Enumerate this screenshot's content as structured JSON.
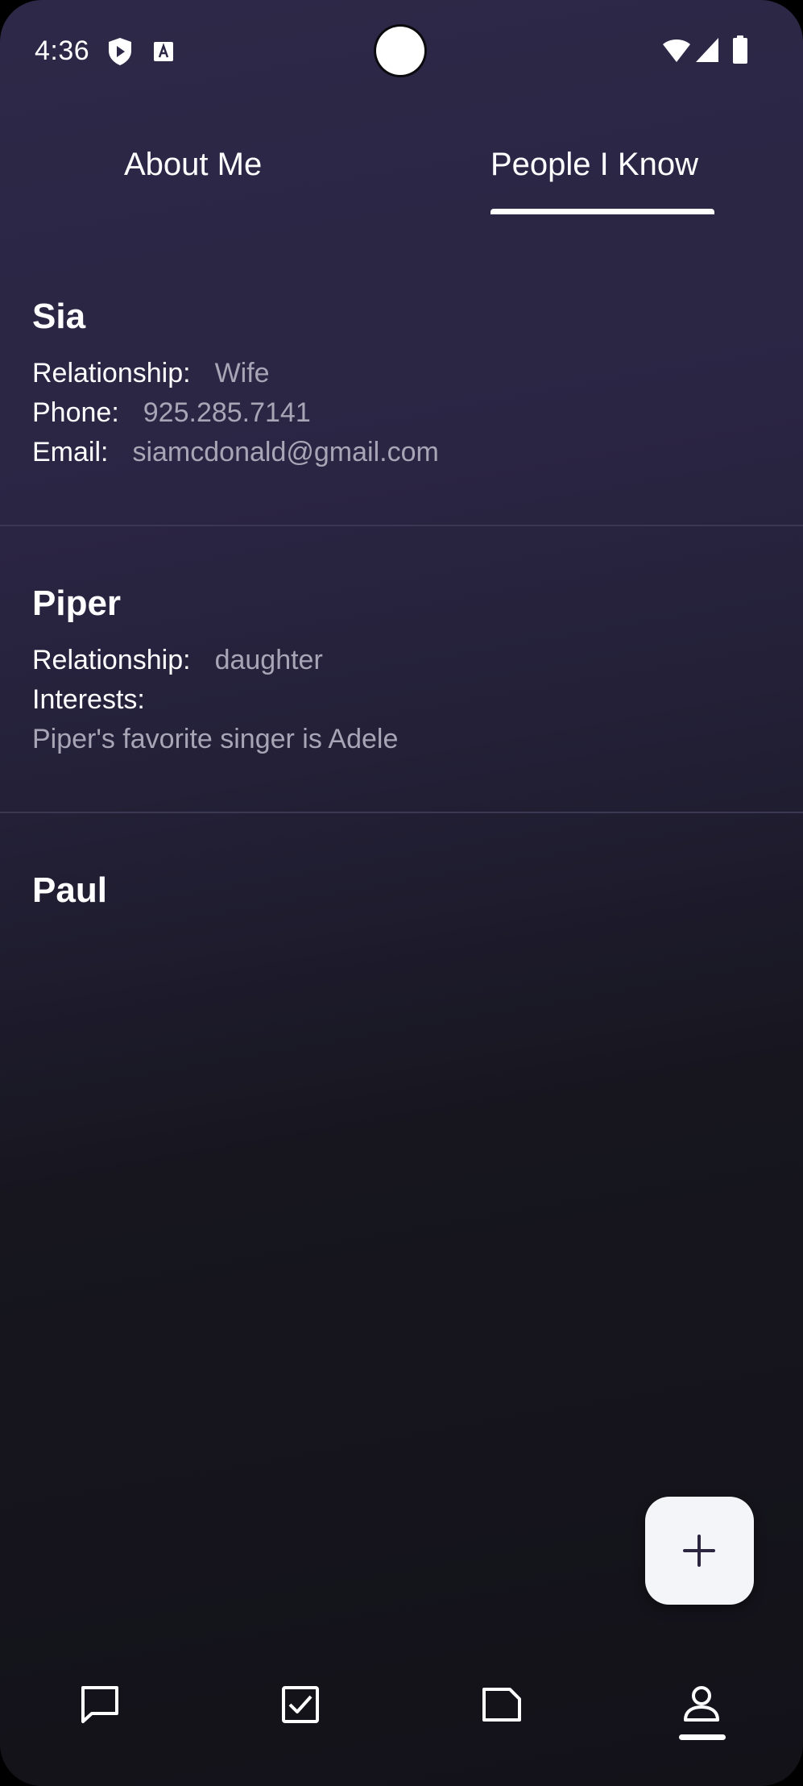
{
  "status_bar": {
    "time": "4:36",
    "left_icons": [
      "shield-play-icon",
      "font-a-icon"
    ],
    "right_icons": [
      "wifi-icon",
      "signal-icon",
      "battery-icon"
    ]
  },
  "tabs": [
    {
      "label": "About Me",
      "selected": false
    },
    {
      "label": "People I Know",
      "selected": true
    }
  ],
  "contacts": [
    {
      "name": "Sia",
      "relationship_label": "Relationship:",
      "relationship": "Wife",
      "phone_label": "Phone:",
      "phone": "925.285.7141",
      "email_label": "Email:",
      "email": "siamcdonald@gmail.com"
    },
    {
      "name": "Piper",
      "relationship_label": "Relationship:",
      "relationship": "daughter",
      "interests_label": "Interests:",
      "interests": "Piper's favorite singer is Adele"
    },
    {
      "name": "Paul"
    }
  ],
  "fab": {
    "icon": "plus-icon"
  },
  "bottom_nav": {
    "items": [
      {
        "icon": "chat-icon"
      },
      {
        "icon": "checkbox-icon"
      },
      {
        "icon": "note-icon"
      },
      {
        "icon": "person-icon",
        "selected": true
      }
    ]
  },
  "colors": {
    "background_top": "#2e2848",
    "background_bottom": "#131219",
    "muted_text": "#a8a5b6",
    "fab_background": "#f4f5f8",
    "fab_icon": "#2b2540"
  }
}
